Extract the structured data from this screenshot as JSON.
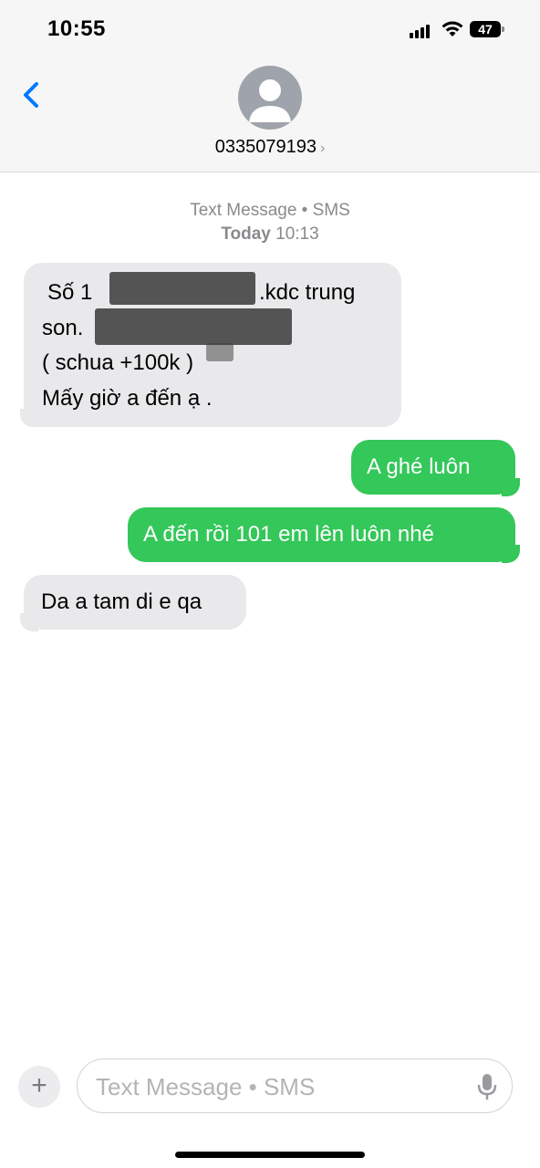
{
  "status_bar": {
    "time": "10:55",
    "battery": "47"
  },
  "header": {
    "contact": "0335079193"
  },
  "thread": {
    "service": "Text Message • SMS",
    "day": "Today",
    "time": "10:13"
  },
  "messages": [
    {
      "direction": "incoming",
      "lines": [
        "Số 1",
        ".kdc trung",
        "son.",
        "( schua +100k )",
        "Mấy giờ a đến ạ ."
      ]
    },
    {
      "direction": "outgoing",
      "text": "A ghé luôn"
    },
    {
      "direction": "outgoing",
      "text": "A đến rồi 101 em lên luôn nhé"
    },
    {
      "direction": "incoming",
      "text": "Da a tam di e qa"
    }
  ],
  "composer": {
    "placeholder": "Text Message • SMS"
  },
  "colors": {
    "accent": "#007aff",
    "outgoing_bubble": "#34c759",
    "incoming_bubble": "#e9e9eb"
  },
  "icons": [
    "back-chevron-icon",
    "person-icon",
    "microphone-icon",
    "plus-icon",
    "wifi-icon",
    "signal-icon",
    "battery-icon"
  ]
}
